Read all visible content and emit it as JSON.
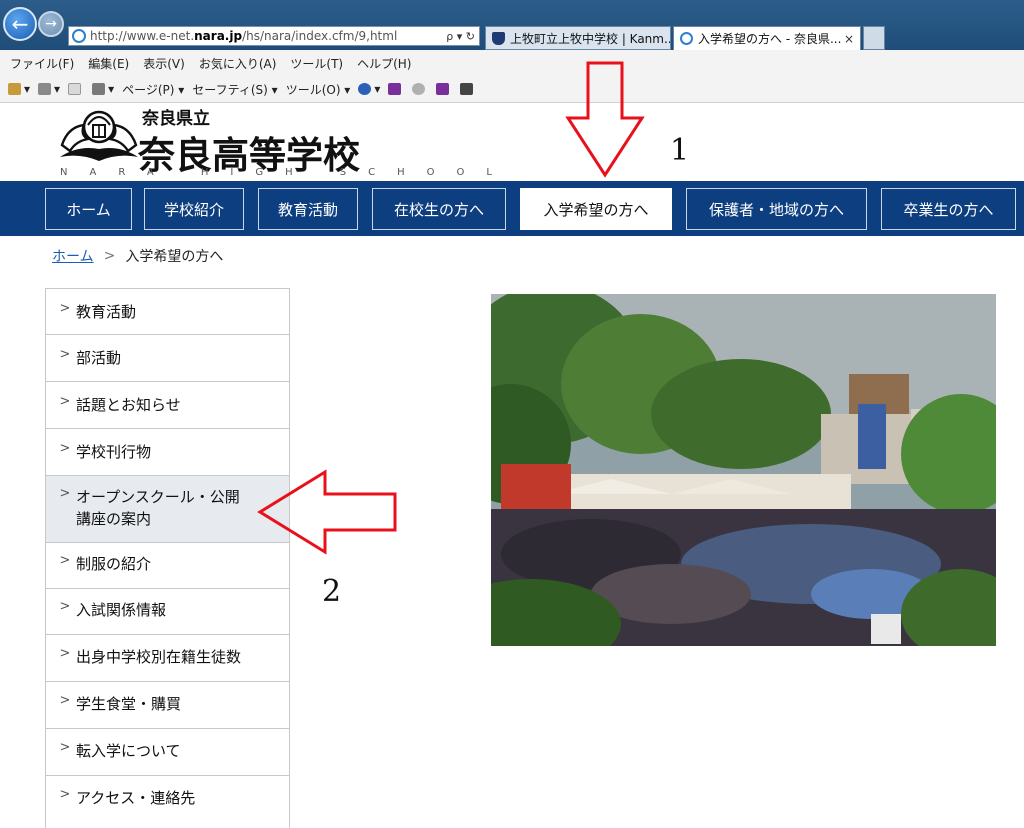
{
  "browser": {
    "address_url_prefix": "http://www.e-net.",
    "address_url_bold": "nara.jp",
    "address_url_suffix": "/hs/nara/index.cfm/9,html",
    "address_controls": "ρ ▾ ↻",
    "tabs": [
      {
        "title": "上牧町立上牧中学校 | Kanm...",
        "icon": "shield-icon"
      },
      {
        "title": "入学希望の方へ - 奈良県...",
        "icon": "ie-icon",
        "close": "×"
      }
    ],
    "menu": [
      "ファイル(F)",
      "編集(E)",
      "表示(V)",
      "お気に入り(A)",
      "ツール(T)",
      "ヘルプ(H)"
    ],
    "commands": [
      "ページ(P) ▾",
      "セーフティ(S) ▾",
      "ツール(O) ▾"
    ]
  },
  "site": {
    "prefecture": "奈良県立",
    "school_name": "奈良高等学校",
    "school_name_en": "NARA HIGH SCHOOL"
  },
  "global_nav": [
    {
      "label": "ホーム"
    },
    {
      "label": "学校紹介"
    },
    {
      "label": "教育活動"
    },
    {
      "label": "在校生の方へ"
    },
    {
      "label": "入学希望の方へ",
      "active": true
    },
    {
      "label": "保護者・地域の方へ"
    },
    {
      "label": "卒業生の方へ"
    }
  ],
  "breadcrumb": {
    "home": "ホーム",
    "separator": ">",
    "current": "入学希望の方へ"
  },
  "side_menu": [
    {
      "label": "教育活動"
    },
    {
      "label": "部活動"
    },
    {
      "label": "話題とお知らせ"
    },
    {
      "label": "学校刊行物"
    },
    {
      "label": "オープンスクール・公開講座の案内",
      "line1": "オープンスクール・公開",
      "line2": "講座の案内",
      "highlighted": true
    },
    {
      "label": "制服の紹介"
    },
    {
      "label": "入試関係情報"
    },
    {
      "label": "出身中学校別在籍生徒数"
    },
    {
      "label": "学生食堂・購買"
    },
    {
      "label": "転入学について"
    },
    {
      "label": "アクセス・連絡先"
    }
  ],
  "annotations": {
    "label_1": "1",
    "label_2": "2",
    "arrow_color": "#e8101a"
  },
  "colors": {
    "nav_bg": "#0d3f80",
    "link": "#1a5fb4",
    "highlight_bg": "#e7ebf0"
  }
}
